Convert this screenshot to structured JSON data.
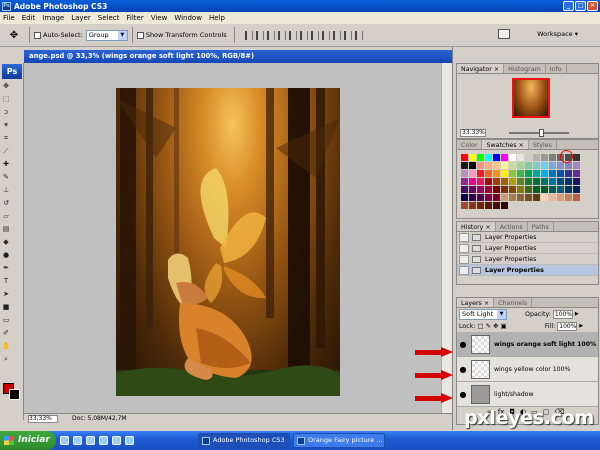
{
  "window": {
    "title": "Adobe Photoshop CS3",
    "app_icon": "Ps"
  },
  "menu": [
    "File",
    "Edit",
    "Image",
    "Layer",
    "Select",
    "Filter",
    "View",
    "Window",
    "Help"
  ],
  "options_bar": {
    "auto_select_label": "Auto-Select:",
    "auto_select_value": "Group",
    "transform_label": "Show Transform Controls",
    "workspace_label": "Workspace ▾"
  },
  "toolbox": {
    "logo": "Ps"
  },
  "document": {
    "title": "ange.psd @ 33,3% (wings orange soft light 100%, RGB/8#)",
    "zoom": "33,33%",
    "doc_info": "Doc: 5,08M/42,7M"
  },
  "navigator": {
    "tabs": [
      "Navigator ×",
      "Histogram",
      "Info"
    ],
    "zoom": "33.33%"
  },
  "color_panel": {
    "tabs": [
      "Color",
      "Swatches ×",
      "Styles"
    ]
  },
  "history": {
    "tabs": [
      "History ×",
      "Actions",
      "Paths"
    ],
    "items": [
      "Layer Properties",
      "Layer Properties",
      "Layer Properties",
      "Layer Properties"
    ]
  },
  "layers": {
    "tabs": [
      "Layers ×",
      "Channels"
    ],
    "blend_mode": "Soft Light",
    "opacity_label": "Opacity:",
    "opacity_value": "100%",
    "lock_label": "Lock:",
    "fill_label": "Fill:",
    "fill_value": "100%",
    "items": [
      {
        "name": "wings orange soft light 100%",
        "selected": true
      },
      {
        "name": "wings yellow color 100%",
        "selected": false
      },
      {
        "name": "light/shadow",
        "selected": false
      }
    ]
  },
  "taskbar": {
    "start_label": "Iniciar",
    "items": [
      "Adobe Photoshop CS3",
      "Orange Fairy picture ..."
    ]
  },
  "watermark": "pxleyes.com",
  "colors": {
    "accent_red": "#d40000",
    "title_blue": "#0a5fd8"
  }
}
